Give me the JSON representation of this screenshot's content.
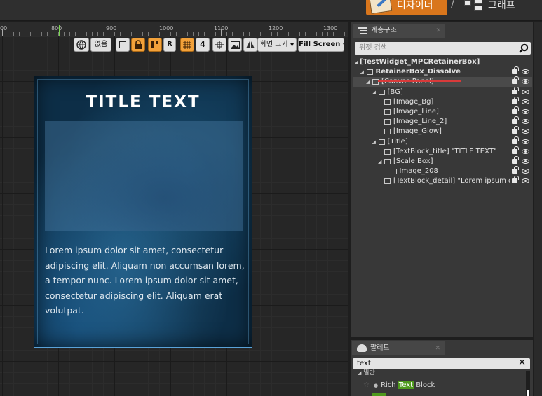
{
  "topbar": {
    "designer_label": "디자이너",
    "separator": "/",
    "graph_label": "그래프"
  },
  "ruler": {
    "labels": [
      "00",
      "800",
      "900",
      "1000",
      "1100",
      "1200",
      "1300"
    ]
  },
  "viewport_toolbar": {
    "none_label": "없음",
    "r_label": "R",
    "screen_size_label": "화면 크기",
    "fill_screen_label": "Fill Screen"
  },
  "widget": {
    "title": "TITLE TEXT",
    "detail": "Lorem ipsum dolor sit amet, consectetur adipiscing elit. Aliquam non accumsan lorem, a tempor nunc. Lorem ipsum dolor sit amet, consectetur adipiscing elit. Aliquam erat volutpat."
  },
  "hierarchy": {
    "tab_label": "계층구조",
    "search_placeholder": "위젯 검색",
    "items": [
      {
        "label": "[TestWidget_MPCRetainerBox]",
        "depth": 0,
        "arrow": true,
        "icon": "none",
        "bold": true
      },
      {
        "label": "RetainerBox_Dissolve",
        "depth": 1,
        "arrow": true,
        "icon": "retainer-box-icon",
        "bold": true
      },
      {
        "label": "[Canvas Panel]",
        "depth": 2,
        "arrow": true,
        "icon": "canvas-panel-icon",
        "bold": false
      },
      {
        "label": "[BG]",
        "depth": 3,
        "arrow": true,
        "icon": "canvas-panel-icon",
        "bold": false
      },
      {
        "label": "[Image_Bg]",
        "depth": 4,
        "arrow": false,
        "icon": "image-icon",
        "bold": false
      },
      {
        "label": "[Image_Line]",
        "depth": 4,
        "arrow": false,
        "icon": "image-icon",
        "bold": false
      },
      {
        "label": "[Image_Line_2]",
        "depth": 4,
        "arrow": false,
        "icon": "image-icon",
        "bold": false
      },
      {
        "label": "[Image_Glow]",
        "depth": 4,
        "arrow": false,
        "icon": "image-icon",
        "bold": false
      },
      {
        "label": "[Title]",
        "depth": 3,
        "arrow": true,
        "icon": "vertical-box-icon",
        "bold": false
      },
      {
        "label": "[TextBlock_title] \"TITLE TEXT\"",
        "depth": 4,
        "arrow": false,
        "icon": "text-block-icon",
        "bold": false
      },
      {
        "label": "[Scale Box]",
        "depth": 4,
        "arrow": true,
        "icon": "scale-box-icon",
        "bold": false
      },
      {
        "label": "Image_208",
        "depth": 5,
        "arrow": false,
        "icon": "image-icon",
        "bold": false
      },
      {
        "label": "[TextBlock_detail] \"Lorem ipsum d",
        "depth": 4,
        "arrow": false,
        "icon": "text-block-icon",
        "bold": false
      }
    ]
  },
  "palette": {
    "tab_label": "팔레트",
    "search_value": "text",
    "category_label": "일반",
    "item_pre": "Rich ",
    "item_match": "Text",
    "item_post": " Block"
  },
  "colors": {
    "accent_orange": "#d9761c",
    "highlight_green": "#4f9a1d",
    "underline_red": "#d83a3a",
    "widget_border": "#5aa3d9"
  }
}
